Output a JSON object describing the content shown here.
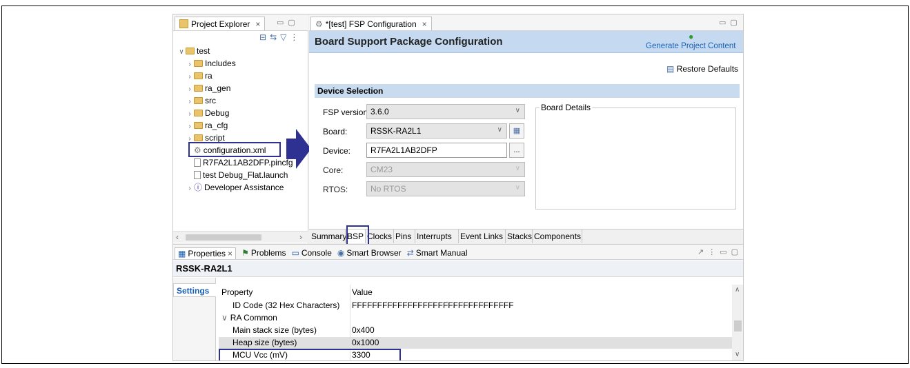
{
  "project_explorer": {
    "tab_label": "Project Explorer",
    "close_glyph": "×",
    "root": "test",
    "items": [
      {
        "label": "Includes",
        "kind": "folder",
        "twisty": "›"
      },
      {
        "label": "ra",
        "kind": "folder",
        "twisty": "›"
      },
      {
        "label": "ra_gen",
        "kind": "folder",
        "twisty": "›"
      },
      {
        "label": "src",
        "kind": "folder",
        "twisty": "›"
      },
      {
        "label": "Debug",
        "kind": "folder",
        "twisty": "›"
      },
      {
        "label": "ra_cfg",
        "kind": "folder",
        "twisty": "›"
      },
      {
        "label": "script",
        "kind": "folder",
        "twisty": "›"
      },
      {
        "label": "configuration.xml",
        "kind": "gear-file",
        "twisty": ""
      },
      {
        "label": "R7FA2L1AB2DFP.pincfg",
        "kind": "file",
        "twisty": ""
      },
      {
        "label": "test Debug_Flat.launch",
        "kind": "file",
        "twisty": ""
      },
      {
        "label": "Developer Assistance",
        "kind": "help",
        "twisty": "›"
      }
    ]
  },
  "editor": {
    "tab_label": "*[test] FSP Configuration",
    "close_glyph": "×",
    "header_title": "Board Support Package Configuration",
    "generate_label": "Generate Project Content",
    "restore_label": "Restore Defaults",
    "section_title": "Device Selection",
    "fsp_version_label": "FSP version:",
    "fsp_version_value": "3.6.0",
    "board_label": "Board:",
    "board_value": "RSSK-RA2L1",
    "device_label": "Device:",
    "device_value": "R7FA2L1AB2DFP",
    "device_btn": "...",
    "core_label": "Core:",
    "core_value": "CM23",
    "rtos_label": "RTOS:",
    "rtos_value": "No RTOS",
    "board_details_label": "Board Details",
    "bottom_tabs": [
      "Summary",
      "BSP",
      "Clocks",
      "Pins",
      "Interrupts",
      "Event Links",
      "Stacks",
      "Components"
    ]
  },
  "bottom_panel": {
    "tabs": [
      {
        "label": "Properties",
        "close": "×"
      },
      {
        "label": "Problems"
      },
      {
        "label": "Console"
      },
      {
        "label": "Smart Browser"
      },
      {
        "label": "Smart Manual"
      }
    ],
    "title": "RSSK-RA2L1",
    "side_tab": "Settings",
    "col_property": "Property",
    "col_value": "Value",
    "rows": [
      {
        "property": "ID Code (32 Hex Characters)",
        "value": "FFFFFFFFFFFFFFFFFFFFFFFFFFFFFFFF",
        "indent": 2
      },
      {
        "property": "RA Common",
        "value": "",
        "indent": 0,
        "twisty": "∨"
      },
      {
        "property": "Main stack size (bytes)",
        "value": "0x400",
        "indent": 2
      },
      {
        "property": "Heap size (bytes)",
        "value": "0x1000",
        "indent": 2
      },
      {
        "property": "MCU Vcc (mV)",
        "value": "3300",
        "indent": 2
      }
    ]
  },
  "colors": {
    "accent": "#2e3192",
    "header_blue": "#c5daf0",
    "section_blue": "#c9dbef",
    "link_blue": "#1a5fb4"
  }
}
